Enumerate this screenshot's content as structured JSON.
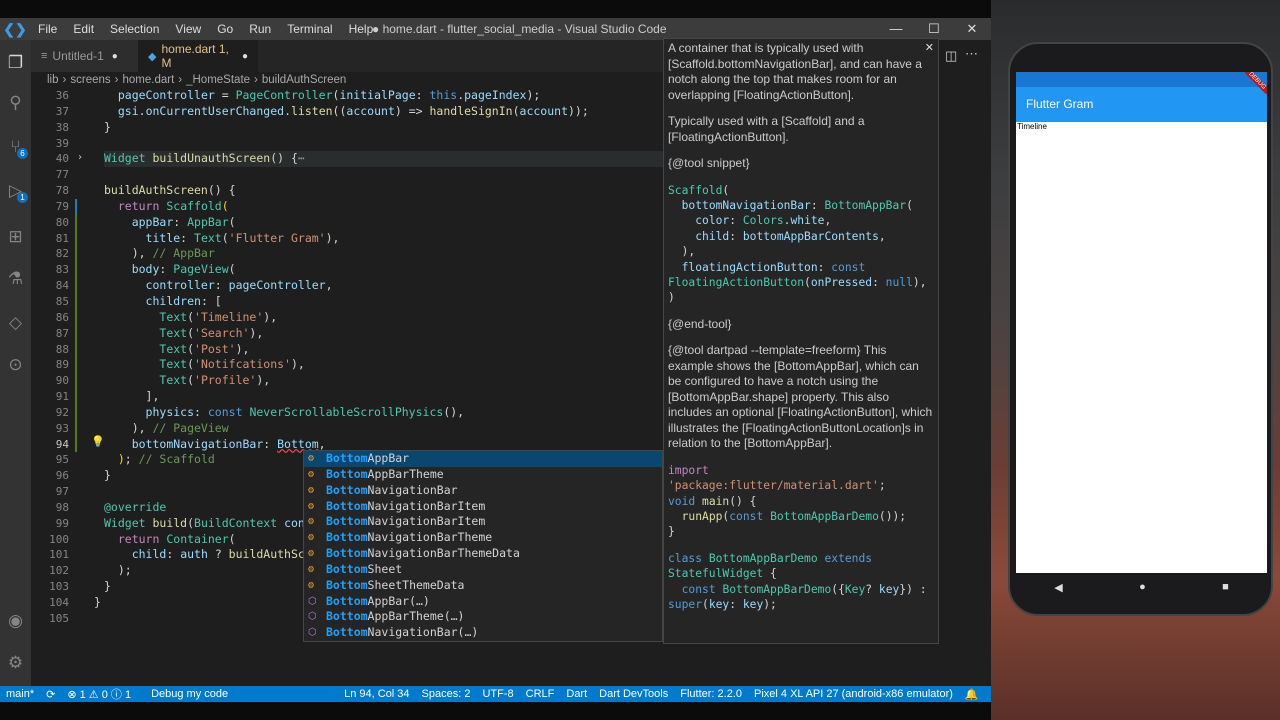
{
  "window": {
    "logo": "❮❯",
    "menu": [
      "File",
      "Edit",
      "Selection",
      "View",
      "Go",
      "Run",
      "Terminal",
      "Help"
    ],
    "title": "● home.dart - flutter_social_media - Visual Studio Code",
    "controls": [
      "—",
      "☐",
      "✕"
    ]
  },
  "activity_badges": [
    "6",
    "1"
  ],
  "tabs": [
    {
      "label": "Untitled-1",
      "icon": "≡",
      "modified": "●"
    },
    {
      "label": "home.dart 1, M",
      "icon": "◆",
      "modified": "●"
    }
  ],
  "breadcrumb": [
    "lib",
    "›",
    "screens",
    "›",
    "home.dart",
    "›",
    "_HomeState",
    "›",
    "buildAuthScreen"
  ],
  "editor": {
    "line_numbers": [
      "36",
      "37",
      "38",
      "39",
      "40",
      "77",
      "78",
      "79",
      "80",
      "81",
      "82",
      "83",
      "84",
      "85",
      "86",
      "87",
      "88",
      "89",
      "90",
      "91",
      "92",
      "93",
      "94",
      "95",
      "96",
      "97",
      "98",
      "99",
      "100",
      "101",
      "102",
      "103",
      "104",
      "105"
    ],
    "current_line": "94"
  },
  "suggestions": {
    "match": "Bottom",
    "items": [
      {
        "rest": "AppBar",
        "kind": "class"
      },
      {
        "rest": "AppBarTheme",
        "kind": "class"
      },
      {
        "rest": "NavigationBar",
        "kind": "class"
      },
      {
        "rest": "NavigationBarItem",
        "kind": "class"
      },
      {
        "rest": "NavigationBarItem",
        "kind": "class"
      },
      {
        "rest": "NavigationBarTheme",
        "kind": "class"
      },
      {
        "rest": "NavigationBarThemeData",
        "kind": "class"
      },
      {
        "rest": "Sheet",
        "kind": "class"
      },
      {
        "rest": "SheetThemeData",
        "kind": "class"
      },
      {
        "rest": "AppBar(…)",
        "kind": "constructor"
      },
      {
        "rest": "AppBarTheme(…)",
        "kind": "constructor"
      },
      {
        "rest": "NavigationBar(…)",
        "kind": "constructor"
      }
    ]
  },
  "doc": {
    "close": "✕",
    "p1": "A container that is typically used with [Scaffold.bottomNavigationBar], and can have a notch along the top that makes room for an overlapping [FloatingActionButton].",
    "p2": "Typically used with a [Scaffold] and a [FloatingActionButton].",
    "p3": "{@tool snippet}",
    "p4": "{@end-tool}",
    "p5": "{@tool dartpad --template=freeform} This example shows the [BottomAppBar], which can be configured to have a notch using the [BottomAppBar.shape] property. This also includes an optional [FloatingActionButton], which illustrates the [FloatingActionButtonLocation]s in relation to the [BottomAppBar]."
  },
  "statusbar": {
    "branch": "main*",
    "sync": "⟳",
    "problems": "⊗ 1 ⚠ 0 ⓘ 1",
    "debug": "Debug my code",
    "position": "Ln 94, Col 34",
    "spaces": "Spaces: 2",
    "encoding": "UTF-8",
    "eol": "CRLF",
    "language": "Dart",
    "devtools": "Dart DevTools",
    "flutter": "Flutter: 2.2.0",
    "device": "Pixel 4 XL API 27 (android-x86 emulator)"
  },
  "phone": {
    "app_title": "Flutter Gram",
    "debug_banner": "DEBUG",
    "body_text": "Timeline",
    "nav": [
      "◀",
      "●",
      "■"
    ]
  }
}
